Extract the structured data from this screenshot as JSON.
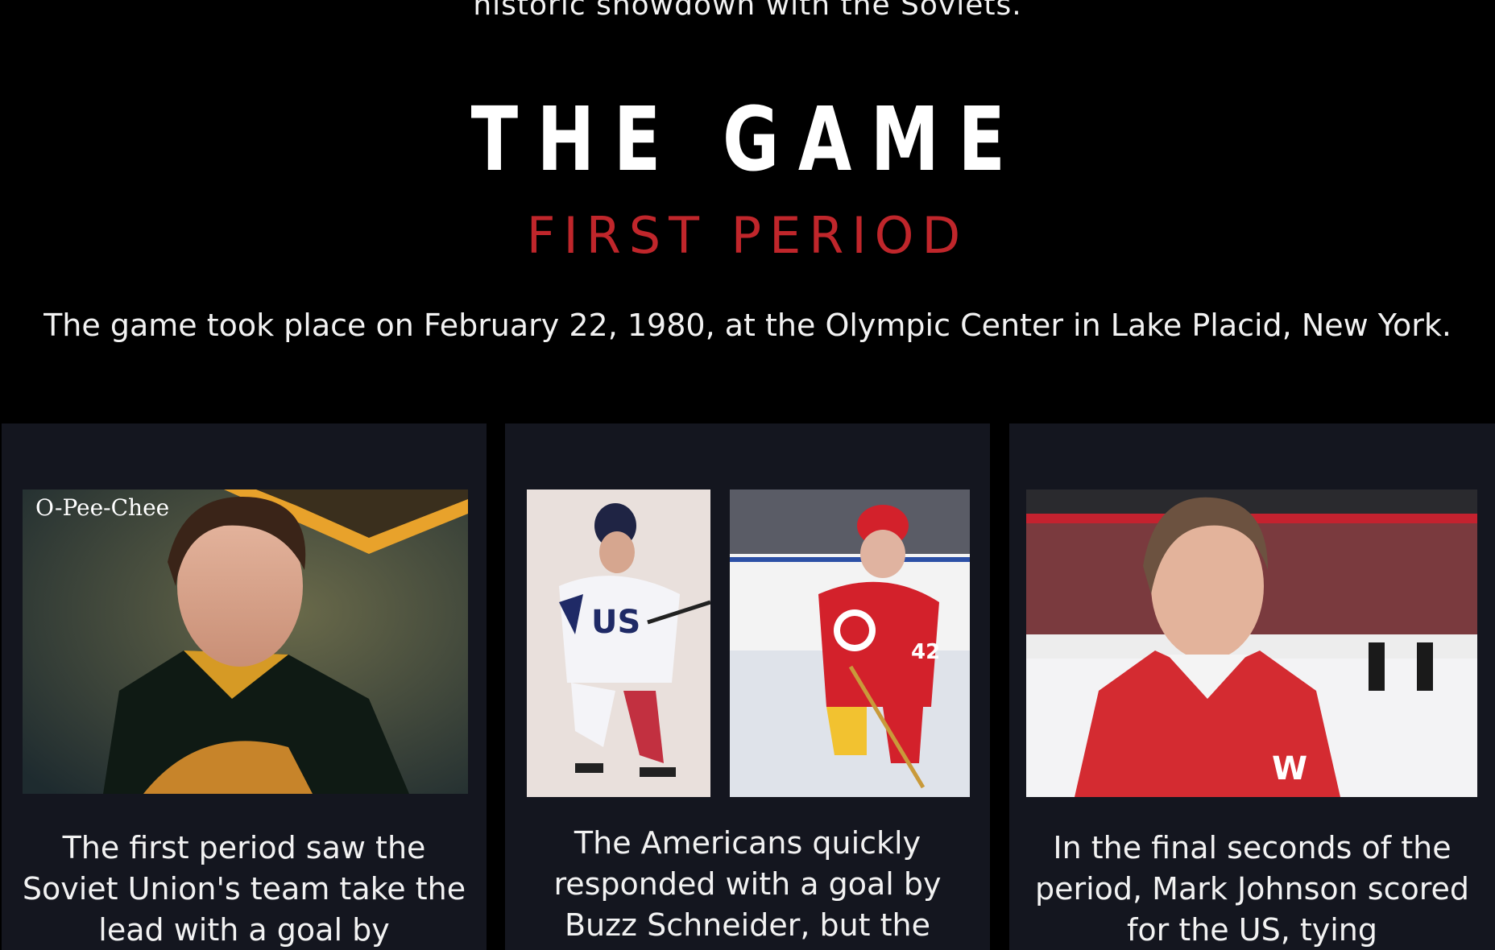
{
  "intro": {
    "text": "historic showdown with the Soviets."
  },
  "section": {
    "title": "THE GAME",
    "subtitle": "FIRST PERIOD",
    "lead": "The game took place on February 22, 1980, at the Olympic Center in Lake Placid, New York."
  },
  "cards": [
    {
      "photo_logo": "O-Pee-Chee",
      "text": "The first period saw the Soviet Union's team take the lead with a goal by"
    },
    {
      "text": "The Americans quickly responded with a goal by Buzz Schneider, but the"
    },
    {
      "text": "In the final seconds of the period, Mark Johnson scored for the US, tying"
    }
  ],
  "colors": {
    "background": "#000000",
    "card_background": "#14161f",
    "accent_red": "#c0262b",
    "text": "#f2f2f2"
  }
}
